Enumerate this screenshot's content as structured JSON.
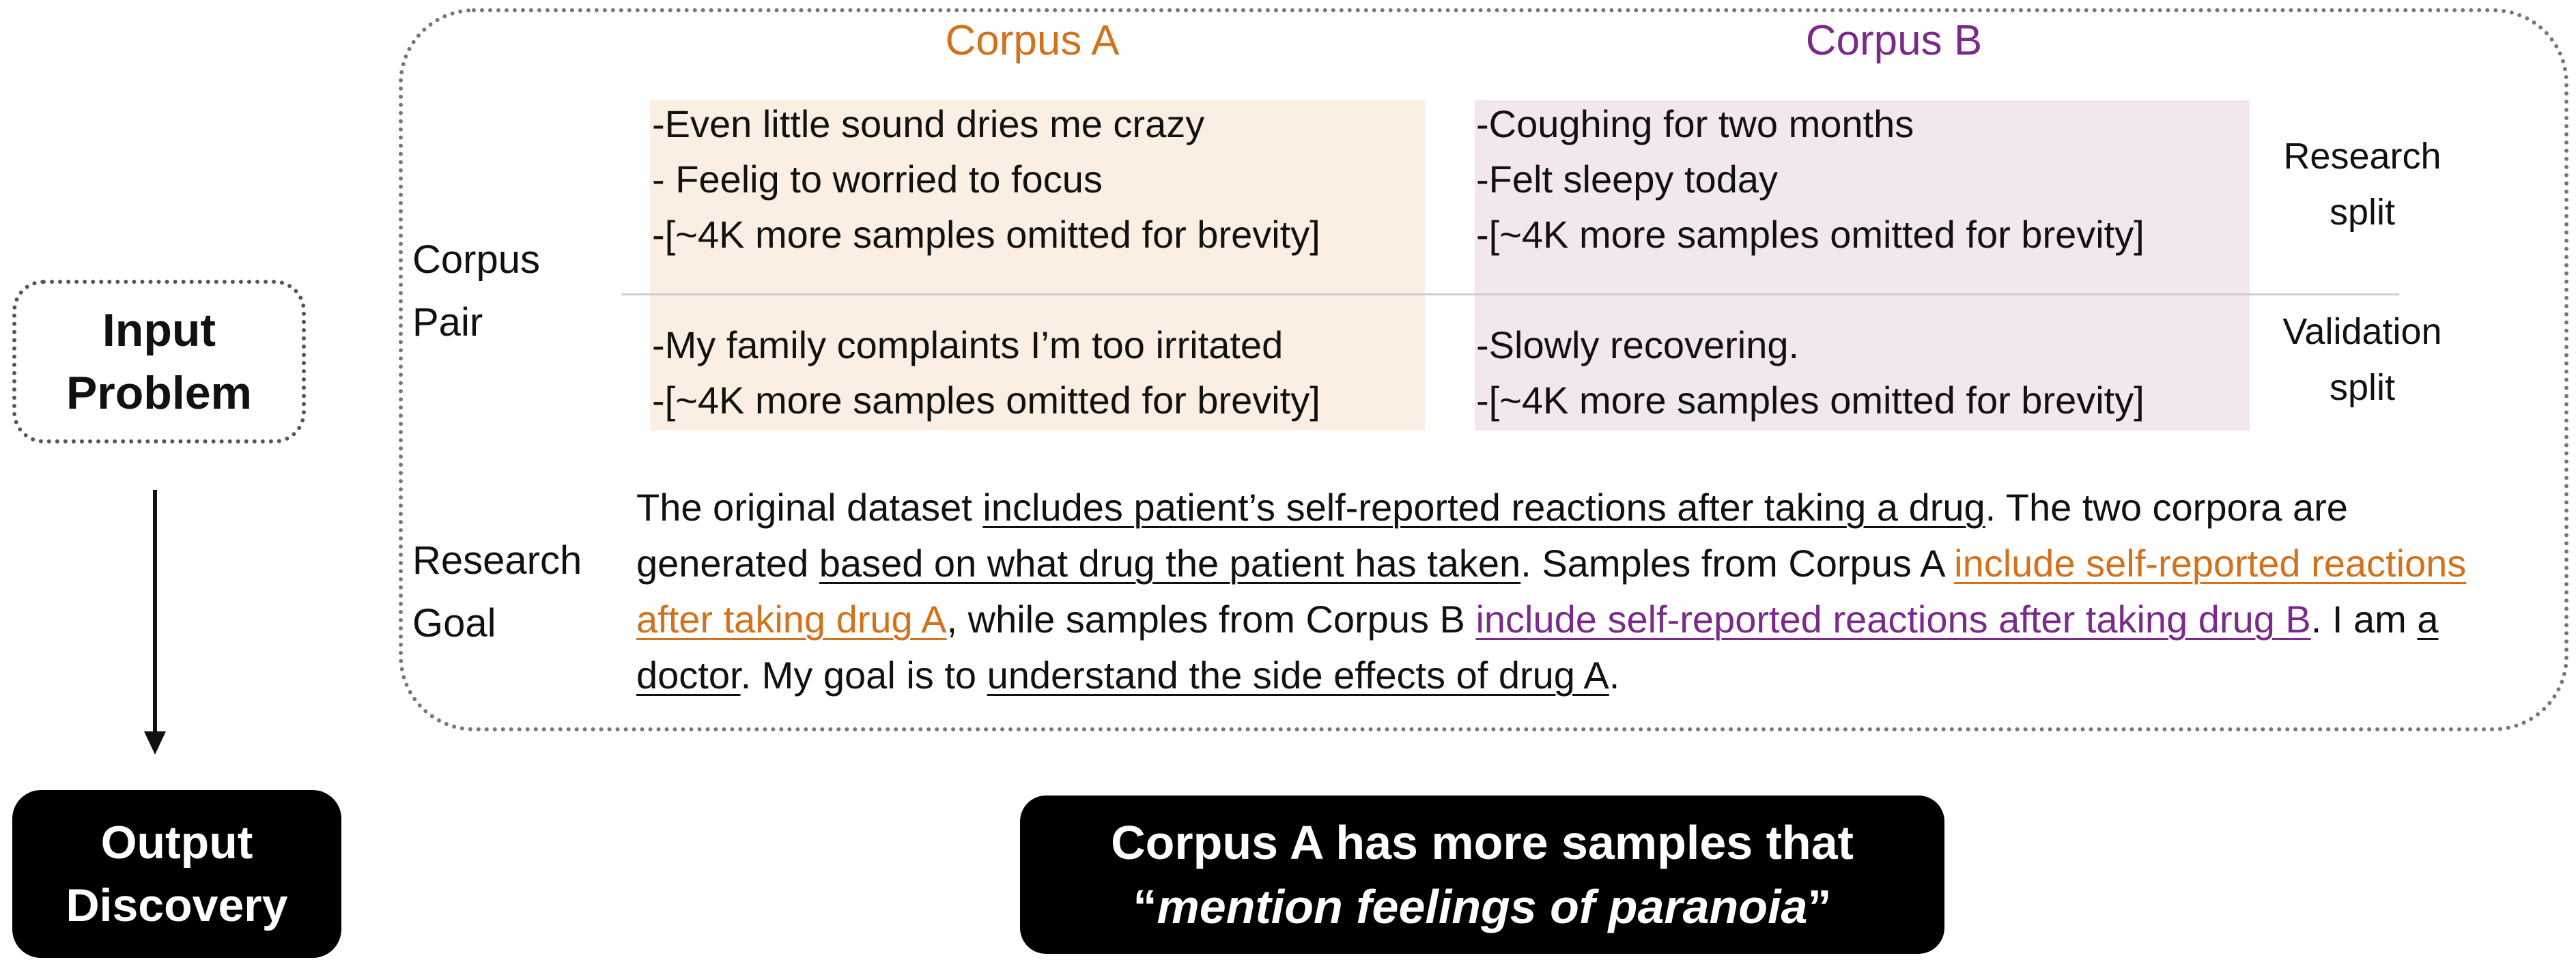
{
  "input_problem": {
    "line1": "Input",
    "line2": "Problem"
  },
  "output_discovery": {
    "line1": "Output",
    "line2": "Discovery"
  },
  "corpus_a_title": "Corpus A",
  "corpus_b_title": "Corpus B",
  "corpus_pair_label": {
    "line1": "Corpus",
    "line2": "Pair"
  },
  "research_goal_label": {
    "line1": "Research",
    "line2": "Goal"
  },
  "research_split": {
    "line1": "Research",
    "line2": "split"
  },
  "validation_split": {
    "line1": "Validation",
    "line2": "split"
  },
  "corpus_a": {
    "research_samples": [
      "-Even little sound dries me crazy",
      "- Feelig to worried to focus",
      "-[~4K more samples omitted for brevity]"
    ],
    "validation_samples": [
      "-My family complaints I’m too irritated",
      "-[~4K more samples omitted for brevity]"
    ]
  },
  "corpus_b": {
    "research_samples": [
      "-Coughing for two months",
      "-Felt sleepy today",
      "-[~4K more samples omitted for brevity]"
    ],
    "validation_samples": [
      "-Slowly recovering.",
      "-[~4K more samples omitted for brevity]"
    ]
  },
  "goal": {
    "p1": "The original dataset ",
    "u1": "includes patient’s self-reported reactions after taking a drug",
    "p2": ". The two corpora are generated ",
    "u2": "based on what drug the patient has taken",
    "p3": ". Samples from Corpus A ",
    "u3_orange": "include self-reported reactions after taking drug A",
    "p4": ", while samples from Corpus B ",
    "u4_purple": "include self-reported reactions after taking drug B",
    "p5": ". I am ",
    "u5": "a doctor",
    "p6": ". My goal is to ",
    "u6": "understand the side effects of drug A",
    "p7": "."
  },
  "discovery": {
    "line1": "Corpus A has more samples that",
    "open_quote": "“",
    "italic": "mention feelings of paranoia",
    "close_quote": "”"
  },
  "colors": {
    "corpus_a": "#d2721c",
    "corpus_b": "#7b2a8c",
    "panel_a_bg": "#fbeee3",
    "panel_b_bg": "#f2e6f1"
  }
}
